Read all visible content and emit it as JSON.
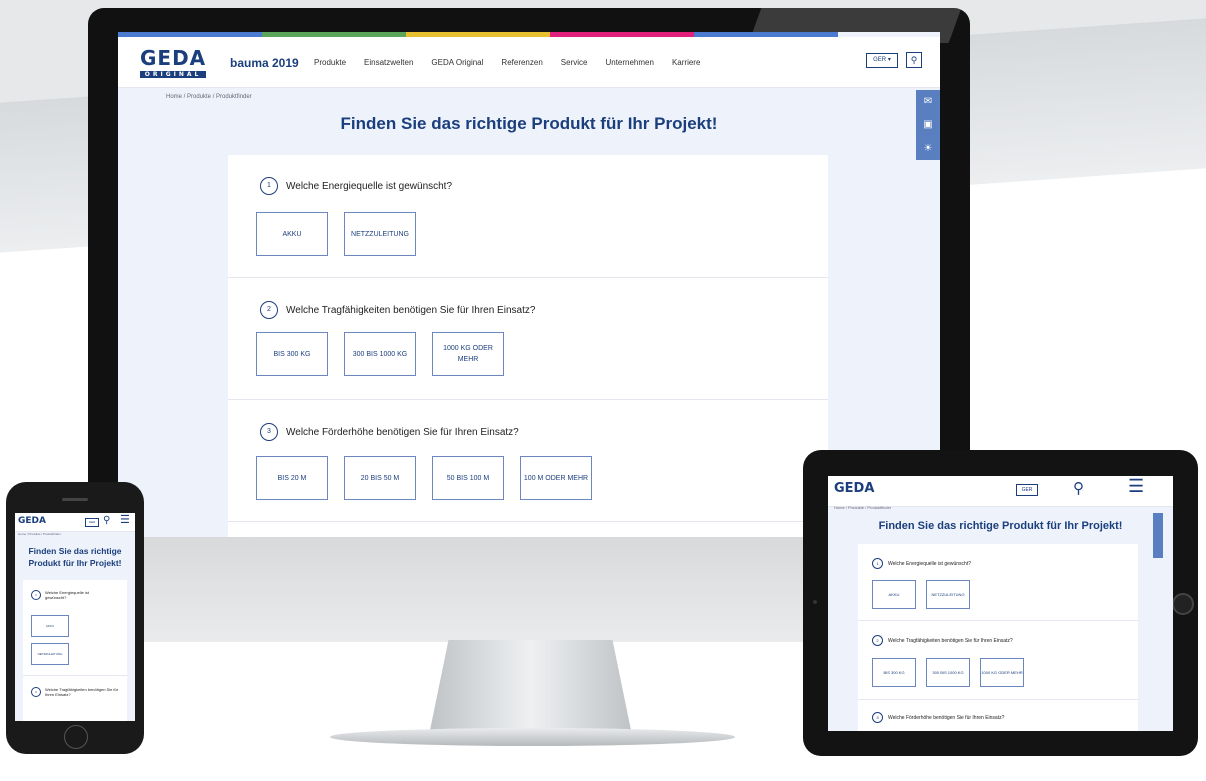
{
  "brand": {
    "logo": "GEDA",
    "logo_sub": "ORIGINAL",
    "accent": "#1b3e7d",
    "strip_colors": [
      "#4a7bd0",
      "#5aa55a",
      "#e6c02e",
      "#e0207a",
      "#4a7bd0"
    ]
  },
  "header": {
    "event": "bauma 2019",
    "nav": [
      "Produkte",
      "Einsatzwelten",
      "GEDA Original",
      "Referenzen",
      "Service",
      "Unternehmen",
      "Karriere"
    ],
    "language": "GER",
    "search_icon": "search-icon"
  },
  "breadcrumb": "Home / Produkte / Produktfinder",
  "title": "Finden Sie das richtige Produkt für Ihr Projekt!",
  "questions": [
    {
      "num": "1",
      "text": "Welche Energiequelle ist gewünscht?",
      "options": [
        "AKKU",
        "NETZZULEITUNG"
      ]
    },
    {
      "num": "2",
      "text": "Welche Tragfähigkeiten benötigen Sie für Ihren Einsatz?",
      "options": [
        "BIS 300 KG",
        "300 BIS 1000 KG",
        "1000 KG ODER MEHR"
      ]
    },
    {
      "num": "3",
      "text": "Welche Förderhöhe benötigen Sie für Ihren Einsatz?",
      "options": [
        "BIS 20 M",
        "20 BIS 50 M",
        "50 BIS 100 M",
        "100 M ODER MEHR"
      ]
    }
  ],
  "side_rail_icons": [
    "mail-icon",
    "document-icon",
    "lightbulb-icon"
  ],
  "mobile": {
    "phone_title": "Finden Sie das richtige Produkt für Ihr Projekt!",
    "phone_q2": "Welche Tragfähigkeiten benötigen Sie für Ihren Einsatz?"
  }
}
